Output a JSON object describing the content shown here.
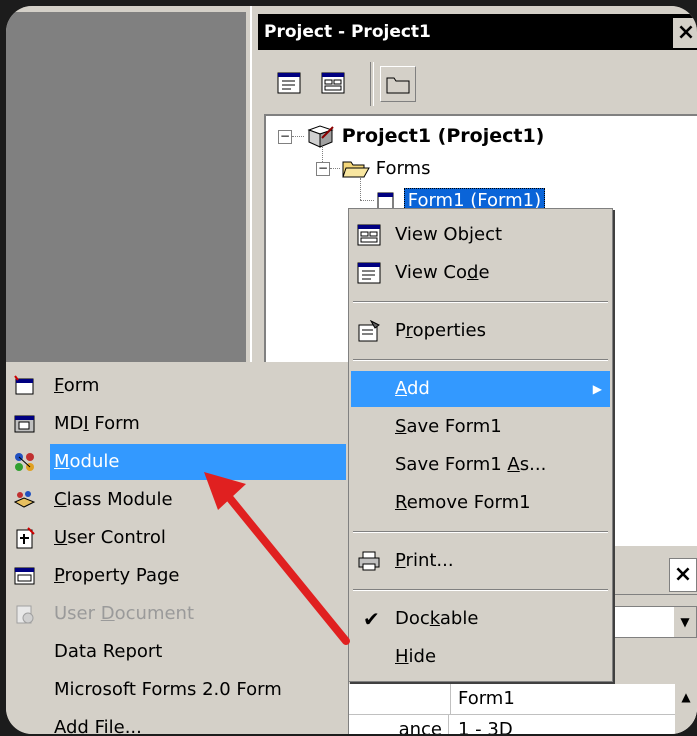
{
  "project_window": {
    "title": "Project - Project1",
    "close": "×",
    "toolbar": [
      {
        "name": "view-code-icon"
      },
      {
        "name": "view-object-icon"
      },
      {
        "name": "toggle-folders-icon"
      }
    ],
    "tree": {
      "root": "Project1 (Project1)",
      "folder": "Forms",
      "item": "Form1 (Form1)"
    }
  },
  "context_menu": {
    "items": [
      {
        "id": "view-object",
        "label": "View Object",
        "u": "j",
        "icon": "view-object-icon"
      },
      {
        "id": "view-code",
        "label": "View Code",
        "u": "d",
        "icon": "view-code-icon"
      },
      {
        "id": "properties",
        "label": "Properties",
        "u": "r",
        "icon": "properties-icon"
      },
      {
        "id": "add",
        "label": "Add",
        "u": "A",
        "arrow": "▶",
        "active": true
      },
      {
        "id": "save-form",
        "label": "Save Form1",
        "u": "S"
      },
      {
        "id": "save-form-as",
        "label": "Save Form1 As...",
        "u": "A"
      },
      {
        "id": "remove-form",
        "label": "Remove Form1",
        "u": "R"
      },
      {
        "id": "print",
        "label": "Print...",
        "u": "P",
        "icon": "printer-icon"
      },
      {
        "id": "dockable",
        "label": "Dockable",
        "u": "k",
        "checked": true,
        "check": "✔"
      },
      {
        "id": "hide",
        "label": "Hide",
        "u": "H"
      }
    ]
  },
  "add_submenu": {
    "items": [
      {
        "id": "form",
        "label": "Form",
        "u": "F",
        "icon": "form-icon"
      },
      {
        "id": "mdi-form",
        "label": "MDI Form",
        "u": "I",
        "icon": "mdi-form-icon"
      },
      {
        "id": "module",
        "label": "Module",
        "u": "M",
        "icon": "module-icon",
        "active": true
      },
      {
        "id": "class-module",
        "label": "Class Module",
        "u": "C",
        "icon": "class-module-icon"
      },
      {
        "id": "user-control",
        "label": "User Control",
        "u": "U",
        "icon": "user-control-icon"
      },
      {
        "id": "property-page",
        "label": "Property Page",
        "u": "P",
        "icon": "property-page-icon"
      },
      {
        "id": "user-document",
        "label": "User Document",
        "u": "D",
        "icon": "user-document-icon",
        "disabled": true
      },
      {
        "id": "data-report",
        "label": "Data Report",
        "u": ""
      },
      {
        "id": "ms-forms",
        "label": "Microsoft Forms 2.0 Form",
        "u": ""
      },
      {
        "id": "add-file",
        "label": "Add File...",
        "u": ""
      }
    ]
  },
  "properties_window": {
    "close": "×",
    "combo_arrow": "▼",
    "scroll_up": "▲",
    "grid": [
      {
        "name": "",
        "value": "Form1"
      },
      {
        "name": "ance",
        "value": "1 - 3D"
      }
    ]
  },
  "annotation": {
    "color": "#e02020"
  },
  "colors": {
    "highlight": "#3399ff",
    "tree_selection": "#0a64d8"
  }
}
